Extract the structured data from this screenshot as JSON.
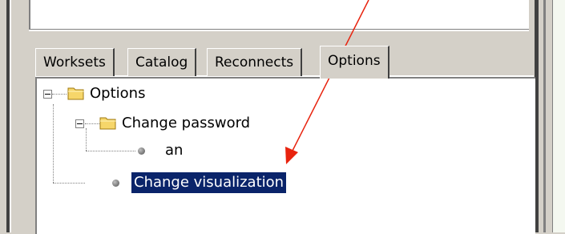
{
  "tabs": [
    {
      "label": "Worksets",
      "active": false
    },
    {
      "label": "Catalog",
      "active": false
    },
    {
      "label": "Reconnects",
      "active": false
    },
    {
      "label": "Options",
      "active": true
    }
  ],
  "tree": {
    "root": {
      "label": "Options",
      "expanded": true,
      "icon": "folder-icon"
    },
    "child_folder": {
      "label": "Change password",
      "expanded": true,
      "icon": "folder-icon"
    },
    "leaf_an": {
      "label": "an",
      "icon": "bullet-icon"
    },
    "leaf_visualization": {
      "label": "Change visualization",
      "icon": "bullet-icon",
      "selected": true
    }
  },
  "colors": {
    "selection_bg": "#0a246a",
    "annotation_arrow": "#e8230e",
    "folder_fill": "#f6d66a",
    "window_bg": "#d4d0c8"
  }
}
